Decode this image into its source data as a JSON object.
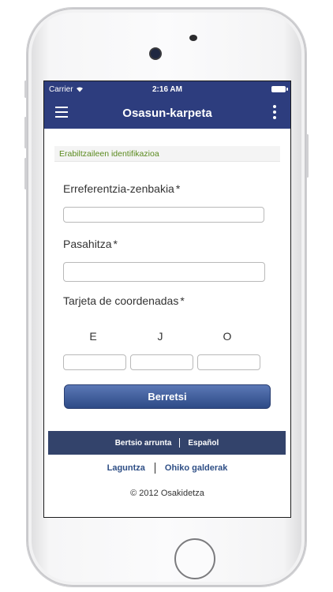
{
  "status": {
    "carrier": "Carrier",
    "time": "2:16 AM"
  },
  "header": {
    "title": "Osasun-karpeta",
    "menu_icon": "hamburger-icon",
    "more_icon": "more-vertical-icon"
  },
  "section": {
    "title": "Erabiltzaileen identifikazioa"
  },
  "form": {
    "reference_label": "Erreferentzia-zenbakia",
    "reference_value": "",
    "password_label": "Pasahitza",
    "password_value": "",
    "coords_label": "Tarjeta de coordenadas",
    "required_mark": "*",
    "coord_letters": [
      "E",
      "J",
      "O"
    ],
    "coord_values": [
      "",
      "",
      ""
    ],
    "submit_label": "Berretsi"
  },
  "footer": {
    "version_link": "Bertsio arrunta",
    "language_link": "Español",
    "help_link": "Laguntza",
    "faq_link": "Ohiko galderak",
    "copyright": "© 2012 Osakidetza"
  },
  "colors": {
    "header": "#2d3d7e",
    "footer": "#33436b",
    "section_text": "#5a8a1e"
  }
}
